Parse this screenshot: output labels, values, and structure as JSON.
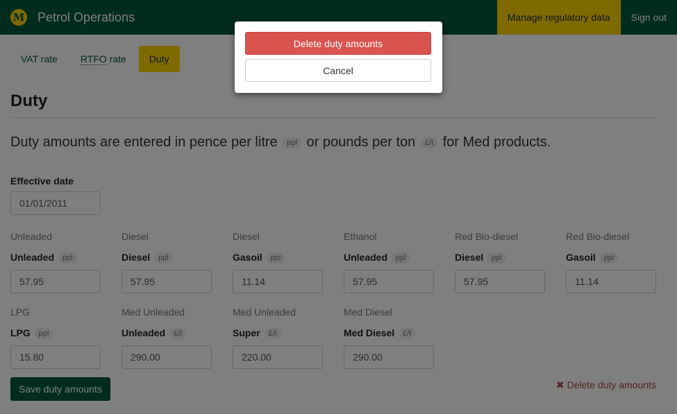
{
  "navbar": {
    "logo_letter": "M",
    "brand": "Petrol Operations",
    "manage_label": "Manage regulatory data",
    "signout_label": "Sign out"
  },
  "tabs": [
    {
      "label": "VAT rate"
    },
    {
      "label": "RTFO",
      "suffix": " rate"
    },
    {
      "label": "Duty"
    }
  ],
  "page": {
    "title": "Duty",
    "lead_part1": "Duty amounts are entered in pence per litre",
    "lead_badge1": "ppl",
    "lead_part2": "or pounds per ton",
    "lead_badge2": "£/t",
    "lead_part3": "for Med products."
  },
  "effective_date": {
    "label": "Effective date",
    "value": "01/01/2011"
  },
  "duties": [
    {
      "category": "Unleaded",
      "product": "Unleaded",
      "unit": "ppl",
      "value": "57.95"
    },
    {
      "category": "Diesel",
      "product": "Diesel",
      "unit": "ppl",
      "value": "57.95"
    },
    {
      "category": "Diesel",
      "product": "Gasoil",
      "unit": "ppl",
      "value": "11.14"
    },
    {
      "category": "Ethanol",
      "product": "Unleaded",
      "unit": "ppl",
      "value": "57.95"
    },
    {
      "category": "Red Bio-diesel",
      "product": "Diesel",
      "unit": "ppl",
      "value": "57.95"
    },
    {
      "category": "Red Bio-diesel",
      "product": "Gasoil",
      "unit": "ppl",
      "value": "11.14"
    },
    {
      "category": "LPG",
      "product": "LPG",
      "unit": "ppl",
      "value": "15.80"
    },
    {
      "category": "Med Unleaded",
      "product": "Unleaded",
      "unit": "£/t",
      "value": "290.00"
    },
    {
      "category": "Med Unleaded",
      "product": "Super",
      "unit": "£/t",
      "value": "220.00"
    },
    {
      "category": "Med Diesel",
      "product": "Med Diesel",
      "unit": "£/t",
      "value": "290.00"
    }
  ],
  "actions": {
    "save_label": "Save duty amounts",
    "delete_label": "Delete duty amounts"
  },
  "modal": {
    "delete_label": "Delete duty amounts",
    "cancel_label": "Cancel"
  },
  "colors": {
    "brand_green": "#00563f",
    "accent_yellow": "#ffd500",
    "danger_red": "#d9534f"
  }
}
